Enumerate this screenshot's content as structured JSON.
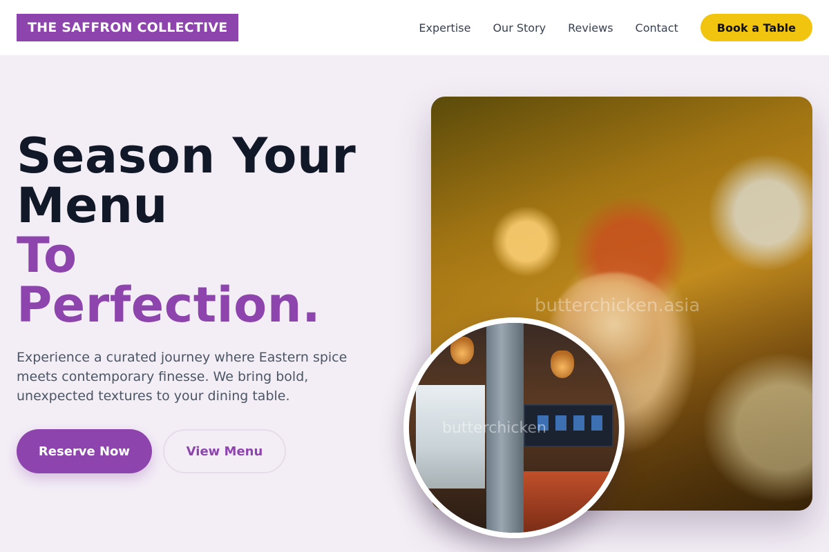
{
  "header": {
    "logo": "THE SAFFRON COLLECTIVE",
    "nav": [
      "Expertise",
      "Our Story",
      "Reviews",
      "Contact"
    ],
    "cta": "Book a Table"
  },
  "hero": {
    "title_line1": "Season Your",
    "title_line2": "Menu",
    "title_line3": "To",
    "title_line4": "Perfection.",
    "description": "Experience a curated journey where Eastern spice meets contemporary finesse. We bring bold, unexpected textures to your dining table.",
    "primary_button": "Reserve Now",
    "secondary_button": "View Menu"
  },
  "images": {
    "main_watermark": "butterchicken.asia",
    "circle_watermark": "butterchicken"
  },
  "colors": {
    "accent": "#8e44ad",
    "cta_yellow": "#f1c40f",
    "background": "#f3eef6",
    "heading": "#111827"
  }
}
